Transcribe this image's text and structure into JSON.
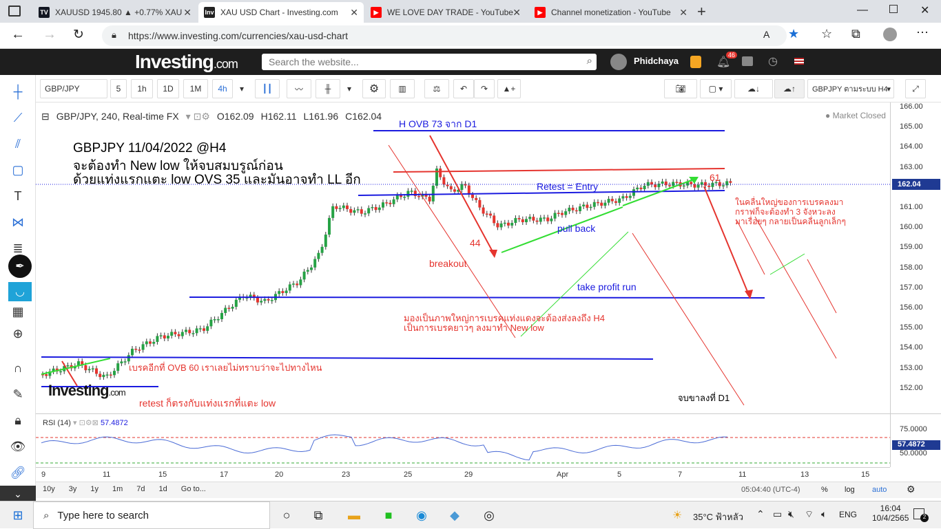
{
  "browser": {
    "tabs": [
      {
        "label": "XAUUSD 1945.80 ▲ +0.77% XAU",
        "active": false
      },
      {
        "label": "XAU USD Chart - Investing.com",
        "active": true
      },
      {
        "label": "WE LOVE DAY TRADE - YouTube",
        "active": false
      },
      {
        "label": "Channel monetization - YouTube",
        "active": false
      }
    ],
    "url": "https://www.investing.com/currencies/xau-usd-chart"
  },
  "site": {
    "logo": "Investing",
    "logo_suffix": ".com",
    "search_placeholder": "Search the website...",
    "username": "Phidchaya",
    "notifications": "46"
  },
  "toolbar": {
    "symbol": "GBP/JPY",
    "intervals": [
      "5",
      "1h",
      "1D",
      "1M",
      "4h"
    ],
    "layout_name": "GBPJPY ตามระบบ H4"
  },
  "chart_header": {
    "title": "GBP/JPY, 240, Real-time FX",
    "ohlc": {
      "O": "162.09",
      "H": "162.11",
      "L": "161.96",
      "C": "162.04"
    },
    "status": "Market Closed",
    "current_price": "162.04"
  },
  "annotations": {
    "title1": "GBPJPY 11/04/2022 @H4",
    "title2": "จะต้องทำ New low ให้จบสมบรูณ์ก่อน",
    "title3": "ด้วยแท่งแรกแตะ low OVS 35 และมันอาจทำ LL อีก",
    "ovb73": "H OVB 73 จาก D1",
    "retest_entry": "Retest = Entry",
    "pullback": "pull back",
    "breakout": "breakout",
    "n44": "44",
    "n61": "61",
    "tp_run": "take profit run",
    "big_picture1": "มองเป็นภาพใหญ่การเบรคแท่งแดงจะต้องส่งลงถึง H4",
    "big_picture2": "เป็นการเบรคยาวๆ ลงมาทำ New low",
    "ovb60": "เบรคอีกที่ OVB 60 เราเลยไม่ทราบว่าจะไปทางไหน",
    "retest_low": "retest ก็ตรงกับแท่งแรกที่แตะ low",
    "right1": "ในคลื่นใหญ่ของการเบรคลงมา",
    "right2": "กราฟก็จะต้องทำ 3 จังหวะลง",
    "right3": "มาเรื่อยๆ กลายเป็นคลื่นลูกเล็กๆ",
    "d1_end": "จบขาลงที่ D1",
    "watermark": "Investing",
    "watermark_suffix": ".com"
  },
  "price_axis": [
    "166.00",
    "165.00",
    "164.00",
    "163.00",
    "162.00",
    "161.00",
    "160.00",
    "159.00",
    "158.00",
    "157.00",
    "156.00",
    "155.00",
    "154.00",
    "153.00",
    "152.00"
  ],
  "rsi": {
    "label": "RSI (14)",
    "value": "57.4872",
    "axis": [
      "75.0000",
      "50.0000"
    ]
  },
  "time_axis": [
    "9",
    "11",
    "15",
    "17",
    "20",
    "23",
    "25",
    "29",
    "Apr",
    "5",
    "7",
    "11",
    "13",
    "15"
  ],
  "bottom": {
    "ranges": [
      "10y",
      "3y",
      "1y",
      "1m",
      "7d",
      "1d",
      "Go to..."
    ],
    "clock": "05:04:40 (UTC-4)",
    "pct": "%",
    "log": "log",
    "auto": "auto"
  },
  "taskbar": {
    "search_placeholder": "Type here to search",
    "weather": "35°C ฟ้าหลัว",
    "lang": "ENG",
    "time": "16:04",
    "date": "10/4/2565",
    "notif": "2"
  },
  "colors": {
    "up": "#26a245",
    "down": "#e5342e",
    "blue_line": "#1a1adf",
    "red_line": "#e5342e",
    "green_line": "#33dd33"
  },
  "chart_data": {
    "type": "candlestick",
    "title": "GBP/JPY, 240, Real-time FX",
    "y_range": [
      151.5,
      166.0
    ]
  }
}
